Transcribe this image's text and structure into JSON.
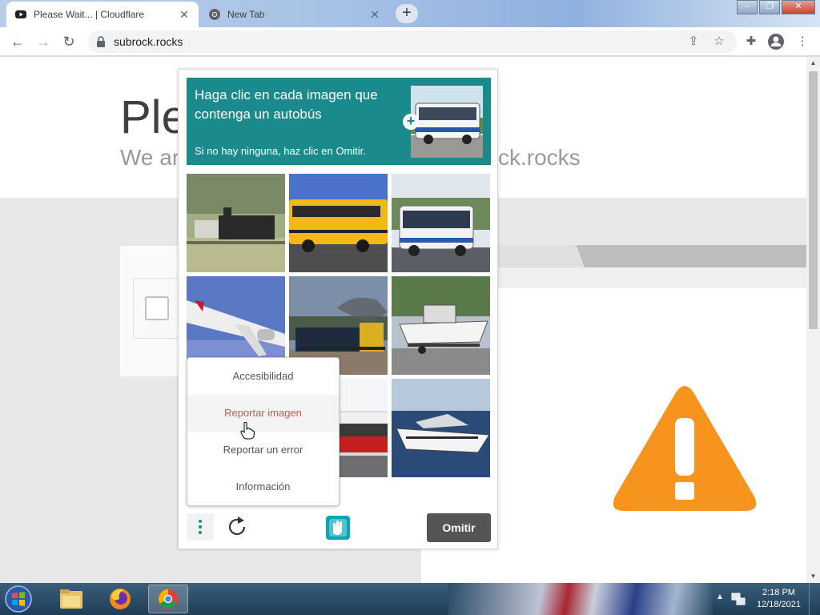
{
  "browser": {
    "tabs": [
      {
        "title": "Please Wait... | Cloudflare",
        "active": true
      },
      {
        "title": "New Tab",
        "active": false
      }
    ],
    "new_tab_label": "+",
    "url": "subrock.rocks"
  },
  "page": {
    "title": "Ple",
    "subtitle_left": "We ar",
    "subtitle_right": "ck.rocks"
  },
  "captcha": {
    "prompt": "Haga clic en cada imagen que contenga un autobús",
    "hint": "Si no hay ninguna, haz clic en Omitir.",
    "grid": [
      {
        "subject": "steam-locomotive",
        "contains_bus": false
      },
      {
        "subject": "school-bus",
        "contains_bus": true
      },
      {
        "subject": "city-bus",
        "contains_bus": true
      },
      {
        "subject": "airplane",
        "contains_bus": false
      },
      {
        "subject": "freight-train",
        "contains_bus": false
      },
      {
        "subject": "boat-on-trailer",
        "contains_bus": false
      },
      {
        "subject": "hidden",
        "contains_bus": false
      },
      {
        "subject": "red-train",
        "contains_bus": false
      },
      {
        "subject": "speedboat",
        "contains_bus": false
      }
    ],
    "menu": {
      "items": [
        {
          "label": "Accesibilidad",
          "hover": false
        },
        {
          "label": "Reportar imagen",
          "hover": true
        },
        {
          "label": "Reportar un error",
          "hover": false
        },
        {
          "label": "Información",
          "hover": false
        }
      ]
    },
    "skip_label": "Omitir",
    "colors": {
      "accent": "#1a8a8c",
      "hover_text": "#d9534f",
      "button": "#555555"
    }
  },
  "taskbar": {
    "time": "2:18 PM",
    "date": "12/18/2021"
  },
  "warning_color": "#f7941d"
}
